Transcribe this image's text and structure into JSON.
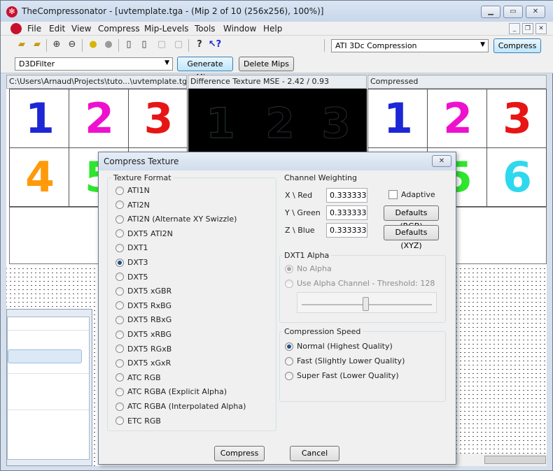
{
  "window": {
    "title": "TheCompressonator - [uvtemplate.tga - (Mip 2 of 10 (256x256), 100%)]"
  },
  "menu": [
    "File",
    "Edit",
    "View",
    "Compress",
    "Mip-Levels",
    "Tools",
    "Window",
    "Help"
  ],
  "toolbar": {
    "compression_select": "ATI 3Dc Compression",
    "compress_button": "Compress",
    "filter_select": "D3DFilter",
    "generate_mips_button": "Generate Mips",
    "delete_mips_button": "Delete Mips"
  },
  "panes": {
    "original_header": "C:\\Users\\Arnaud\\Projects\\tuto...\\uvtemplate.tga",
    "difference_header": "Difference Texture MSE - 2.42 / 0.93",
    "compressed_header": "Compressed"
  },
  "tiles": {
    "row1": [
      {
        "d": "1",
        "c": "#1d27d6"
      },
      {
        "d": "2",
        "c": "#ee10cf"
      },
      {
        "d": "3",
        "c": "#e81515"
      }
    ],
    "row2": [
      {
        "d": "4",
        "c": "#ff9a0a"
      },
      {
        "d": "5",
        "c": "#2ee62e"
      },
      {
        "d": "6",
        "c": "#2ed8ee"
      }
    ]
  },
  "dialog": {
    "title": "Compress Texture",
    "texture_format_label": "Texture Format",
    "formats": [
      "ATI1N",
      "ATI2N",
      "ATI2N (Alternate XY Swizzle)",
      "DXT5 ATI2N",
      "DXT1",
      "DXT3",
      "DXT5",
      "DXT5 xGBR",
      "DXT5 RxBG",
      "DXT5 RBxG",
      "DXT5 xRBG",
      "DXT5 RGxB",
      "DXT5 xGxR",
      "ATC RGB",
      "ATC RGBA (Explicit Alpha)",
      "ATC RGBA (Interpolated Alpha)",
      "ETC RGB"
    ],
    "selected_format": "DXT3",
    "channel_weighting_label": "Channel Weighting",
    "channels": [
      {
        "label": "X \\ Red",
        "value": "0.333333"
      },
      {
        "label": "Y \\ Green",
        "value": "0.333333"
      },
      {
        "label": "Z \\ Blue",
        "value": "0.333333"
      }
    ],
    "adaptive_label": "Adaptive",
    "defaults_rgb": "Defaults (RGB)",
    "defaults_xyz": "Defaults (XYZ)",
    "dxt1_alpha_label": "DXT1 Alpha",
    "no_alpha": "No Alpha",
    "use_alpha": "Use Alpha Channel - Threshold: 128",
    "threshold": 128,
    "compression_speed_label": "Compression Speed",
    "speeds": [
      "Normal (Highest Quality)",
      "Fast (Slightly Lower Quality)",
      "Super Fast (Lower Quality)"
    ],
    "selected_speed": "Normal (Highest Quality)",
    "compress_button": "Compress",
    "cancel_button": "Cancel"
  }
}
